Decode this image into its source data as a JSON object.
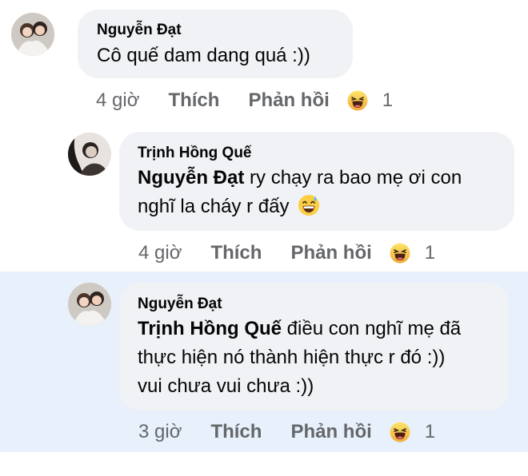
{
  "comments": [
    {
      "author": "Nguyễn Đạt",
      "mention": "",
      "text": "Cô quế dam dang quá :))",
      "time": "4 giờ",
      "like_label": "Thích",
      "reply_label": "Phản hồi",
      "reaction_icon": "haha-emoji-icon",
      "reaction_count": "1"
    },
    {
      "author": "Trịnh Hồng Quế",
      "mention": "Nguyễn Đạt",
      "text_line1": " ry chạy ra bao mẹ ơi con",
      "text_line2": "nghĩ la cháy r đấy",
      "emoji": "grinning-sweat-emoji-icon",
      "time": "4 giờ",
      "like_label": "Thích",
      "reply_label": "Phản hồi",
      "reaction_icon": "haha-emoji-icon",
      "reaction_count": "1"
    },
    {
      "author": "Nguyễn Đạt",
      "mention": "Trịnh Hồng Quế",
      "text_line1": " điều con nghĩ mẹ đã",
      "text_line2": "thực hiện nó thành hiện thực r đó :))",
      "text_line3": "vui chưa vui chưa :))",
      "time": "3 giờ",
      "like_label": "Thích",
      "reply_label": "Phản hồi",
      "reaction_icon": "haha-emoji-icon",
      "reaction_count": "1"
    }
  ],
  "colors": {
    "bubble": "#f0f2f5",
    "highlight": "#e7f0fb",
    "meta_text": "#65676b"
  }
}
